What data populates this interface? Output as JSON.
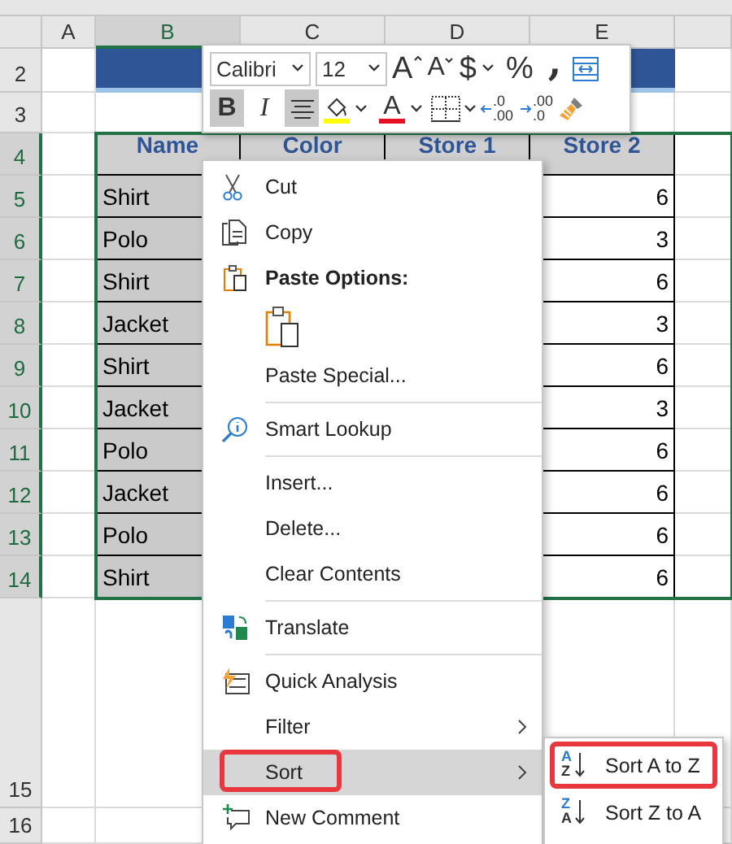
{
  "sheet": {
    "column_headers": [
      {
        "label": "A",
        "selected": false
      },
      {
        "label": "B",
        "selected": true
      },
      {
        "label": "C",
        "selected": false
      },
      {
        "label": "D",
        "selected": false
      },
      {
        "label": "E",
        "selected": false
      }
    ],
    "row_headers": [
      {
        "label": "2",
        "selected": false
      },
      {
        "label": "3",
        "selected": false
      },
      {
        "label": "4",
        "selected": true
      },
      {
        "label": "5",
        "selected": true
      },
      {
        "label": "6",
        "selected": true
      },
      {
        "label": "7",
        "selected": true
      },
      {
        "label": "8",
        "selected": true
      },
      {
        "label": "9",
        "selected": true
      },
      {
        "label": "10",
        "selected": true
      },
      {
        "label": "11",
        "selected": true
      },
      {
        "label": "12",
        "selected": true
      },
      {
        "label": "13",
        "selected": true
      },
      {
        "label": "14",
        "selected": true
      },
      {
        "label": "15",
        "selected": false
      },
      {
        "label": "16",
        "selected": false
      }
    ],
    "table": {
      "columns": [
        "Name",
        "Color",
        "Store 1",
        "Store 2"
      ],
      "rows": [
        {
          "name": "Shirt",
          "store_2": "6"
        },
        {
          "name": "Polo",
          "store_2": "3"
        },
        {
          "name": "Shirt",
          "store_2": "6"
        },
        {
          "name": "Jacket",
          "store_2": "3"
        },
        {
          "name": "Shirt",
          "store_2": "6"
        },
        {
          "name": "Jacket",
          "store_2": "3"
        },
        {
          "name": "Polo",
          "store_2": "6"
        },
        {
          "name": "Jacket",
          "store_2": "6"
        },
        {
          "name": "Polo",
          "store_2": "6"
        },
        {
          "name": "Shirt",
          "store_2": "6"
        }
      ]
    }
  },
  "mini_toolbar": {
    "font": "Calibri",
    "size": "12",
    "grow_font": "A",
    "shrink_font": "A",
    "currency": "$",
    "percent": "%",
    "comma": ",",
    "bold": {
      "label": "B",
      "pressed": true
    },
    "italic": {
      "label": "I",
      "pressed": false
    },
    "center": {
      "pressed": true
    },
    "font_color_letter": "A",
    "increase_decimal": {
      "top": ".0",
      "bottom": ".00"
    },
    "decrease_decimal": {
      "top": ".00",
      "bottom": ".0"
    }
  },
  "context_menu": {
    "items": [
      {
        "kind": "item",
        "label": "Cut",
        "submenu": false,
        "hovered": false,
        "highlighted": false
      },
      {
        "kind": "item",
        "label": "Copy",
        "submenu": false,
        "hovered": false,
        "highlighted": false
      },
      {
        "kind": "header",
        "label": "Paste Options:"
      },
      {
        "kind": "paste"
      },
      {
        "kind": "item",
        "label": "Paste Special...",
        "submenu": false,
        "hovered": false,
        "highlighted": false
      },
      {
        "kind": "separator"
      },
      {
        "kind": "item",
        "label": "Smart Lookup",
        "submenu": false,
        "hovered": false,
        "highlighted": false
      },
      {
        "kind": "separator"
      },
      {
        "kind": "item",
        "label": "Insert...",
        "submenu": false,
        "hovered": false,
        "highlighted": false
      },
      {
        "kind": "item",
        "label": "Delete...",
        "submenu": false,
        "hovered": false,
        "highlighted": false
      },
      {
        "kind": "item",
        "label": "Clear Contents",
        "submenu": false,
        "hovered": false,
        "highlighted": false
      },
      {
        "kind": "separator"
      },
      {
        "kind": "item",
        "label": "Translate",
        "submenu": false,
        "hovered": false,
        "highlighted": false
      },
      {
        "kind": "separator"
      },
      {
        "kind": "item",
        "label": "Quick Analysis",
        "submenu": false,
        "hovered": false,
        "highlighted": false
      },
      {
        "kind": "item",
        "label": "Filter",
        "submenu": true,
        "hovered": false,
        "highlighted": false
      },
      {
        "kind": "item",
        "label": "Sort",
        "submenu": true,
        "hovered": true,
        "highlighted": true
      },
      {
        "kind": "item",
        "label": "New Comment",
        "submenu": false,
        "hovered": false,
        "highlighted": false
      }
    ]
  },
  "submenu": {
    "items": [
      {
        "label": "Sort A to Z",
        "icon_top": "A",
        "icon_bottom": "Z",
        "highlighted": true
      },
      {
        "label": "Sort Z to A",
        "icon_top": "Z",
        "icon_bottom": "A",
        "highlighted": false
      }
    ]
  }
}
